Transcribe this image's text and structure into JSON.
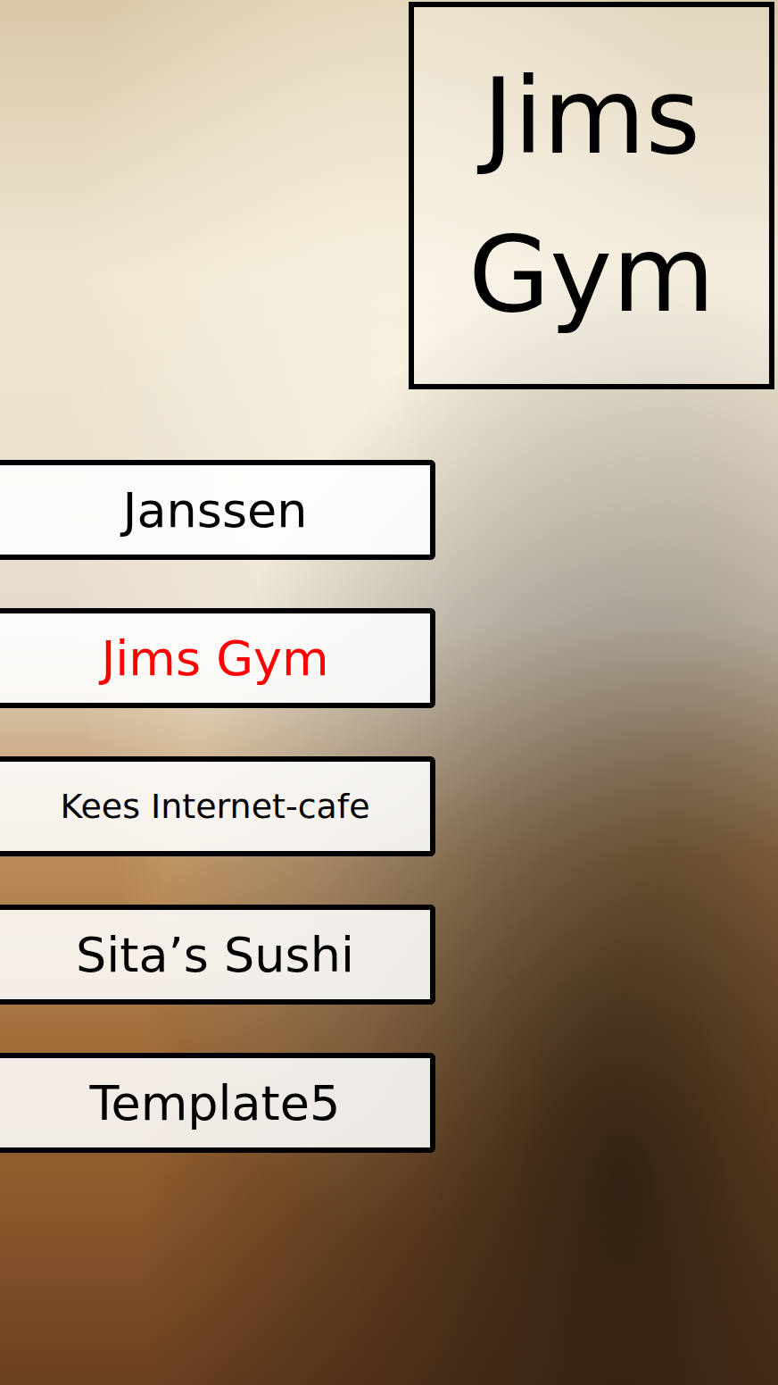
{
  "header": {
    "title": "Jims Gym"
  },
  "menu": {
    "items": [
      {
        "label": "Janssen",
        "selected": false
      },
      {
        "label": "Jims Gym",
        "selected": true
      },
      {
        "label": "Kees Internet-cafe",
        "selected": false
      },
      {
        "label": "Sita’s Sushi",
        "selected": false
      },
      {
        "label": "Template5",
        "selected": false
      }
    ]
  }
}
